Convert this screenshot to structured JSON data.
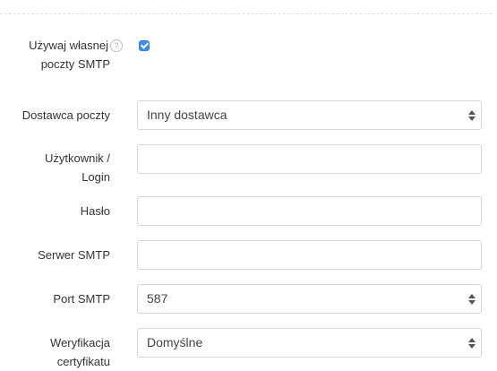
{
  "form": {
    "own_smtp": {
      "label_line1": "Używaj własnej",
      "label_line2": "poczty SMTP",
      "help": "?",
      "checked": true
    },
    "provider": {
      "label": "Dostawca poczty",
      "value": "Inny dostawca"
    },
    "username": {
      "label_line1": "Użytkownik /",
      "label_line2": "Login",
      "value": ""
    },
    "password": {
      "label": "Hasło",
      "value": ""
    },
    "smtp_server": {
      "label": "Serwer SMTP",
      "value": ""
    },
    "smtp_port": {
      "label": "Port SMTP",
      "value": "587"
    },
    "cert_verification": {
      "label_line1": "Weryfikacja",
      "label_line2": "certyfikatu",
      "value": "Domyślne"
    }
  },
  "colors": {
    "checkbox_accent": "#3b8ef0",
    "border": "#d6d6d6",
    "label_text": "#333333"
  }
}
